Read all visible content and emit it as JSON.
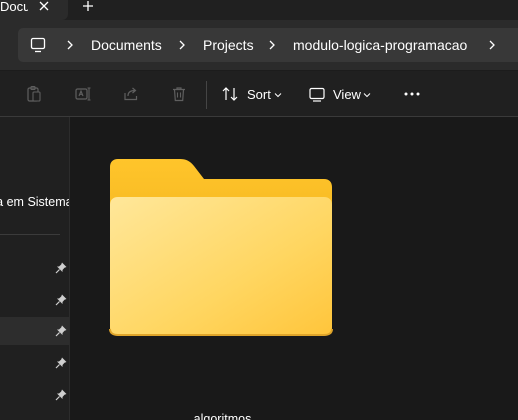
{
  "tab": {
    "title": "Documents"
  },
  "address_bar": {
    "crumbs": [
      "Documents",
      "Projects",
      "modulo-logica-programacao"
    ]
  },
  "command_bar": {
    "sort_label": "Sort",
    "view_label": "View"
  },
  "sidebar": {
    "visible_label": "Assessoria em Sistemas"
  },
  "content": {
    "folder_name": "algoritmos"
  },
  "colors": {
    "folder_back": "#e8a413",
    "folder_front": "#ffd661",
    "accent": "#60cdff"
  }
}
